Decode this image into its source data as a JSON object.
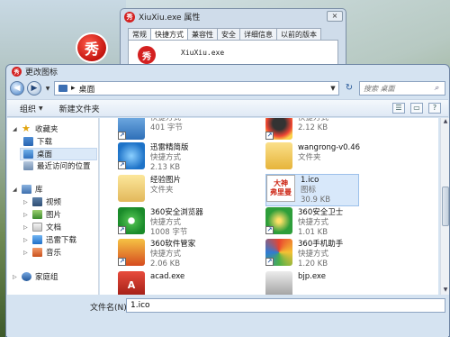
{
  "props_window": {
    "title": "XiuXiu.exe 属性",
    "close_label": "×",
    "tabs": [
      "常规",
      "快捷方式",
      "兼容性",
      "安全",
      "详细信息",
      "以前的版本"
    ],
    "filename": "XiuXiu.exe",
    "logo_glyph": "秀"
  },
  "desktop": {
    "icon_glyph": "秀"
  },
  "dialog": {
    "title": "更改图标",
    "breadcrumb": "桌面",
    "search_placeholder": "搜索 桌面",
    "toolbar": {
      "organize": "组织",
      "new_folder": "新建文件夹"
    },
    "nav": {
      "favorites": "收藏夹",
      "downloads": "下载",
      "desktop": "桌面",
      "recent": "最近访问的位置",
      "libraries": "库",
      "videos": "视频",
      "pictures": "图片",
      "documents": "文档",
      "thunder": "迅雷下载",
      "music": "音乐",
      "homegroup": "家庭组"
    },
    "files": [
      {
        "name": "",
        "type": "快捷方式",
        "size": "401 字节"
      },
      {
        "name": "",
        "type": "快捷方式",
        "size": "2.12 KB"
      },
      {
        "name": "迅雷精简版",
        "type": "快捷方式",
        "size": "2.13 KB"
      },
      {
        "name": "wangrong-v0.46",
        "type": "文件夹",
        "size": ""
      },
      {
        "name": "经验图片",
        "type": "文件夹",
        "size": ""
      },
      {
        "name": "1.ico",
        "type": "图标",
        "size": "30.9 KB",
        "preview_line1": "大神",
        "preview_line2": "弗里曼"
      },
      {
        "name": "360安全浏览器",
        "type": "快捷方式",
        "size": "1008 字节"
      },
      {
        "name": "360安全卫士",
        "type": "快捷方式",
        "size": "1.01 KB"
      },
      {
        "name": "360软件管家",
        "type": "快捷方式",
        "size": "2.06 KB"
      },
      {
        "name": "360手机助手",
        "type": "快捷方式",
        "size": "1.20 KB"
      },
      {
        "name": "acad.exe",
        "type": "",
        "size": ""
      },
      {
        "name": "bjp.exe",
        "type": "",
        "size": ""
      }
    ],
    "filename_label": "文件名(N):",
    "filename_value": "1.ico"
  },
  "colors": {
    "accent": "#3c7bc4",
    "selection": "#d8e8fa",
    "logo_red": "#d42020"
  }
}
